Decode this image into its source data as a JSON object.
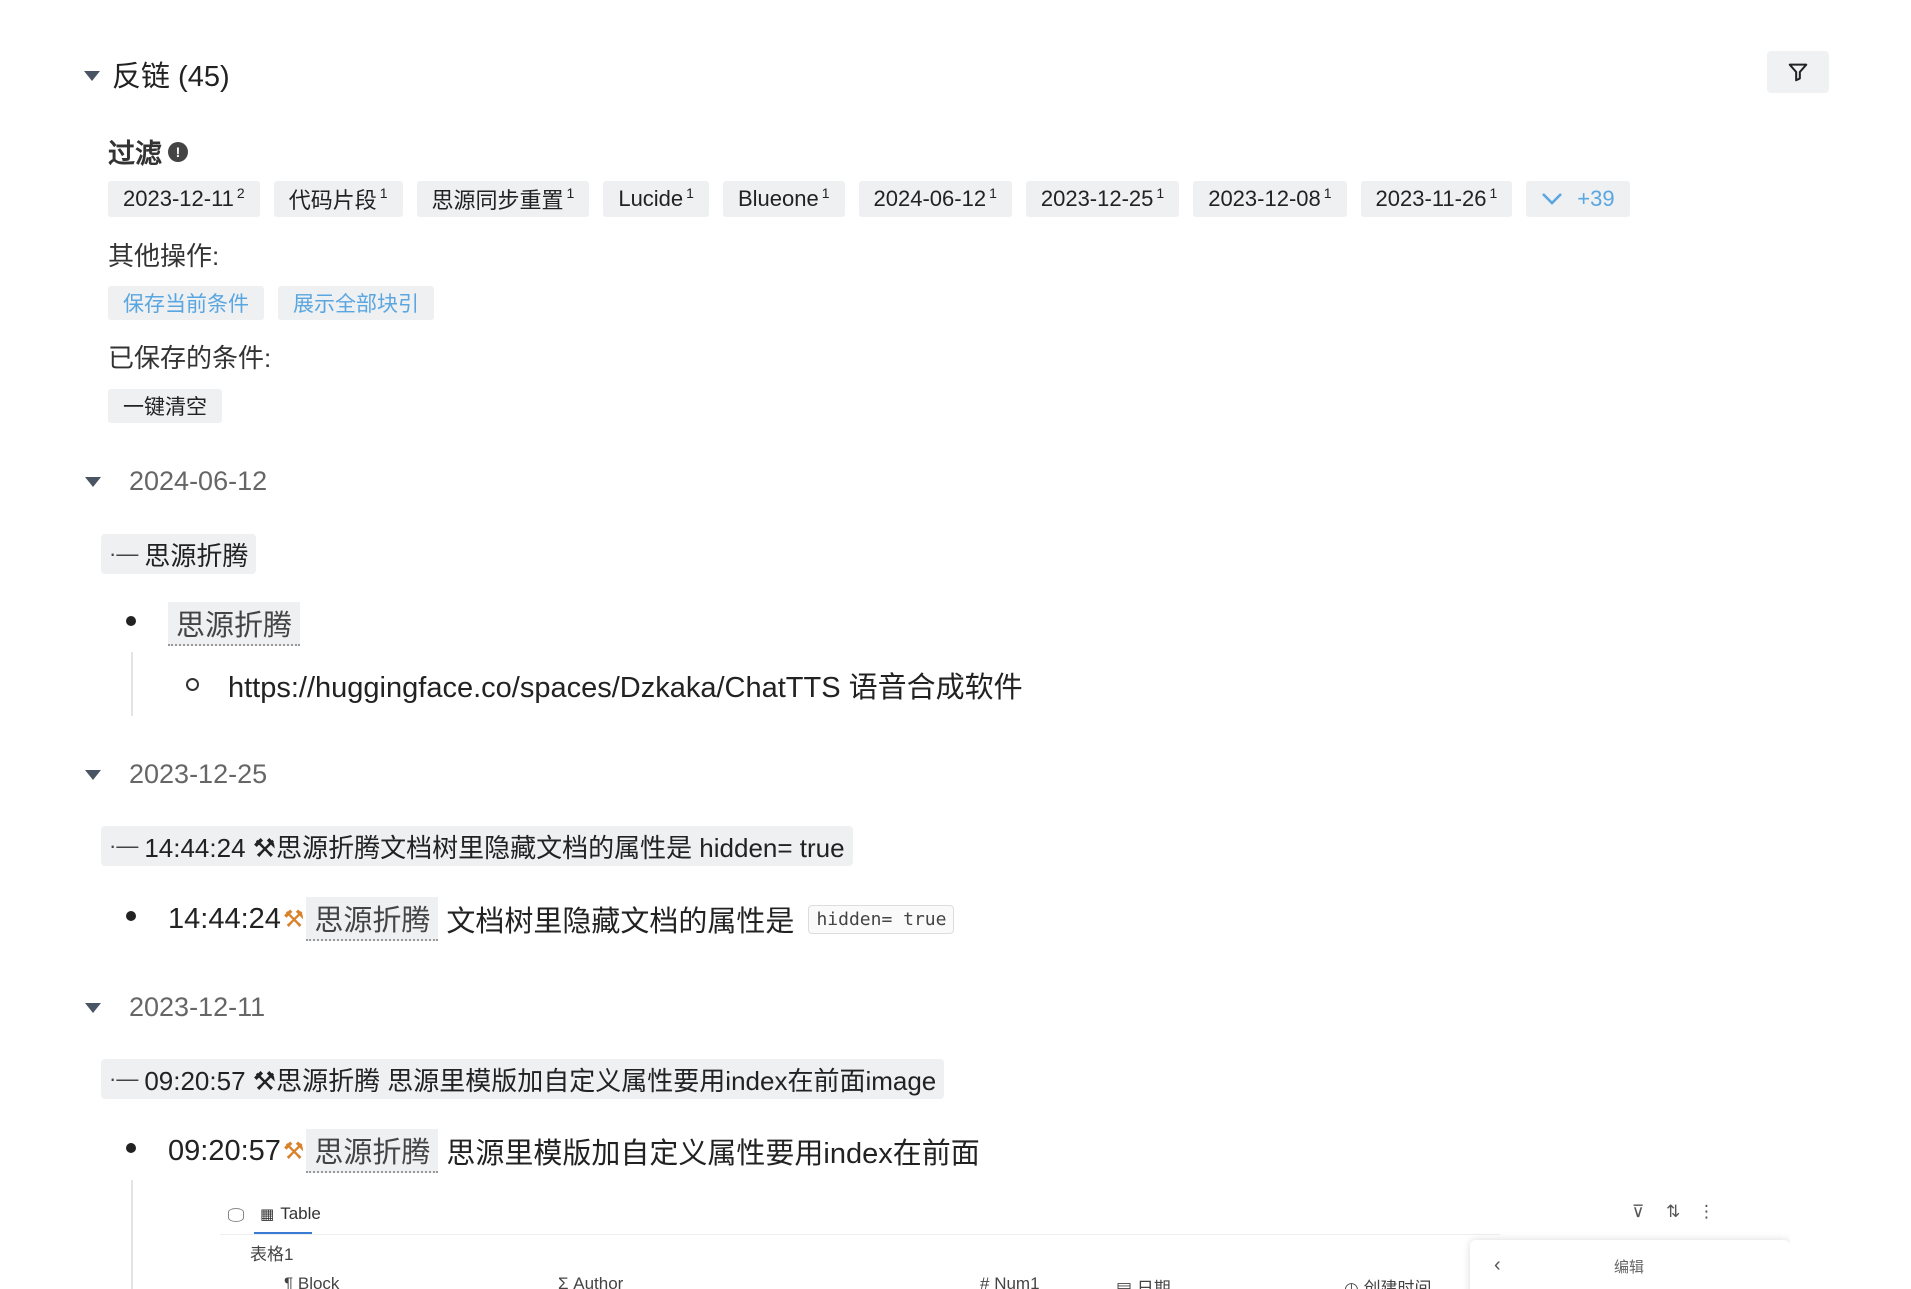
{
  "header": {
    "title": "反链 (45)"
  },
  "filter": {
    "label": "过滤",
    "info_icon": "!",
    "chips": [
      {
        "label": "2023-12-11",
        "count": "2"
      },
      {
        "label": "代码片段",
        "count": "1"
      },
      {
        "label": "思源同步重置",
        "count": "1"
      },
      {
        "label": "Lucide",
        "count": "1"
      },
      {
        "label": "Blueone",
        "count": "1"
      },
      {
        "label": "2024-06-12",
        "count": "1"
      },
      {
        "label": "2023-12-25",
        "count": "1"
      },
      {
        "label": "2023-12-08",
        "count": "1"
      },
      {
        "label": "2023-11-26",
        "count": "1"
      }
    ],
    "more_label": "+39"
  },
  "actions": {
    "label": "其他操作:",
    "save_label": "保存当前条件",
    "show_all_label": "展示全部块引"
  },
  "saved": {
    "label": "已保存的条件:",
    "clear_label": "一键清空"
  },
  "groups": [
    {
      "date": "2024-06-12",
      "breadcrumb": "思源折腾",
      "item_ref": "思源折腾",
      "subitem": "https://huggingface.co/spaces/Dzkaka/ChatTTS 语音合成软件"
    },
    {
      "date": "2023-12-25",
      "breadcrumb": "14:44:24 ⚒思源折腾文档树里隐藏文档的属性是 hidden= true",
      "time": "14:44:24",
      "item_ref": "思源折腾",
      "item_text": "文档树里隐藏文档的属性是",
      "code": "hidden= true"
    },
    {
      "date": "2023-12-11",
      "breadcrumb": "09:20:57 ⚒思源折腾 思源里模版加自定义属性要用index在前面image",
      "time": "09:20:57",
      "item_ref": "思源折腾",
      "item_text": "思源里模版加自定义属性要用index在前面"
    }
  ],
  "embedded_table": {
    "tab_label": "Table",
    "table_name": "表格1",
    "columns": [
      "Block",
      "Author",
      "Num1",
      "日期",
      "创建时间"
    ],
    "side_panel_title": "编辑"
  }
}
